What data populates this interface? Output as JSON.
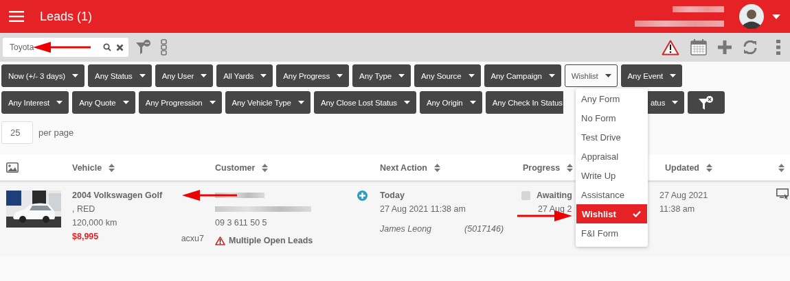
{
  "header": {
    "title": "Leads (1)"
  },
  "toolbar": {
    "search": {
      "value": "Toyota"
    }
  },
  "filter_rows": [
    [
      {
        "label": "Now (+/- 3 days)",
        "open": false
      },
      {
        "label": "Any Status",
        "open": false
      },
      {
        "label": "Any User",
        "open": false
      },
      {
        "label": "All Yards",
        "open": false
      },
      {
        "label": "Any Progress",
        "open": false
      },
      {
        "label": "Any Type",
        "open": false
      },
      {
        "label": "Any Source",
        "open": false
      },
      {
        "label": "Any Campaign",
        "open": false
      },
      {
        "label": "Wishlist",
        "open": true
      },
      {
        "label": "Any Event",
        "open": false
      }
    ],
    [
      {
        "label": "Any Interest",
        "open": false
      },
      {
        "label": "Any Quote",
        "open": false
      },
      {
        "label": "Any Progression",
        "open": false
      },
      {
        "label": "Any Vehicle Type",
        "open": false
      },
      {
        "label": "Any Close Lost Status",
        "open": false
      },
      {
        "label": "Any Origin",
        "open": false
      },
      {
        "label": "Any Check In Status",
        "open": false,
        "kind": "cut_right"
      },
      {
        "label": "atus",
        "open": false,
        "kind": "cut_left"
      }
    ]
  ],
  "dropdown": {
    "options": [
      {
        "label": "Any Form",
        "selected": false
      },
      {
        "label": "No Form",
        "selected": false
      },
      {
        "label": "Test Drive",
        "selected": false
      },
      {
        "label": "Appraisal",
        "selected": false
      },
      {
        "label": "Write Up",
        "selected": false
      },
      {
        "label": "Assistance",
        "selected": false
      },
      {
        "label": "Wishlist",
        "selected": true
      },
      {
        "label": "F&I Form",
        "selected": false
      }
    ]
  },
  "per_page": {
    "value": "25",
    "label": "per page"
  },
  "table": {
    "columns": [
      "Vehicle",
      "Customer",
      "Next Action",
      "Progress",
      "Updated"
    ],
    "rows": [
      {
        "vehicle": {
          "title": "2004 Volkswagen Golf",
          "paint": ", RED",
          "mileage": "120,000 km",
          "price": "$8,995",
          "code": "acxu7"
        },
        "customer": {
          "phone": "09 3 611 50 5",
          "warning": "Multiple Open Leads"
        },
        "next_action": {
          "title": "Today",
          "date": "27 Aug 2021 11:38 am",
          "user": "James Leong",
          "ref": "(5017146)"
        },
        "progress": {
          "status": "Awaiting",
          "date": "27 Aug 2",
          "checked": false
        },
        "updated": {
          "date": "27 Aug 2021",
          "time": "11:38 am"
        }
      }
    ]
  }
}
